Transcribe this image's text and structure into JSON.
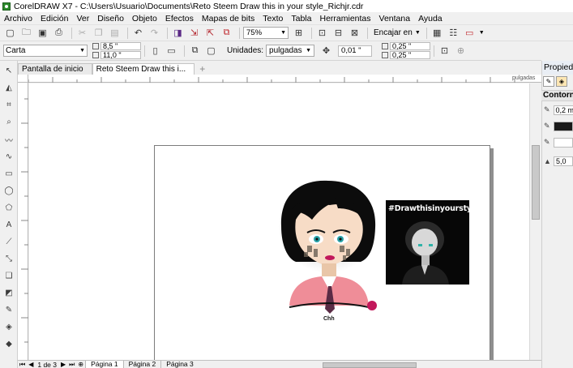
{
  "window": {
    "title": "CorelDRAW X7 - C:\\Users\\Usuario\\Documents\\Reto Steem Draw this in your style_Richjr.cdr"
  },
  "menu": [
    "Archivo",
    "Edición",
    "Ver",
    "Diseño",
    "Objeto",
    "Efectos",
    "Mapas de bits",
    "Texto",
    "Tabla",
    "Herramientas",
    "Ventana",
    "Ayuda"
  ],
  "toolbar": {
    "zoom": "75%",
    "snap_label": "Encajar en"
  },
  "property_bar": {
    "paper": "Carta",
    "width": "8,5 \"",
    "height": "11,0 \"",
    "units_label": "Unidades:",
    "units": "pulgadas",
    "nudge": "0,01 \"",
    "dup_x": "0,25 \"",
    "dup_y": "0,25 \""
  },
  "document_tabs": [
    "Pantalla de inicio",
    "Reto Steem Draw this i..."
  ],
  "ruler": {
    "units": "pulgadas"
  },
  "artwork": {
    "hashtag": "#Drawthisinyourstyle",
    "caption": "Chh"
  },
  "status": {
    "page_count": "1 de 3",
    "pages": [
      "Página 1",
      "Página 2",
      "Página 3"
    ]
  },
  "dock": {
    "title": "Propiedad",
    "section": "Contorno",
    "width_value": "0,2 m",
    "miter_value": "5,0"
  },
  "colors": {
    "hair": "#0c0c0c",
    "skin": "#f7dcc6",
    "shirt": "#ef8d98",
    "lips": "#c2185b"
  }
}
